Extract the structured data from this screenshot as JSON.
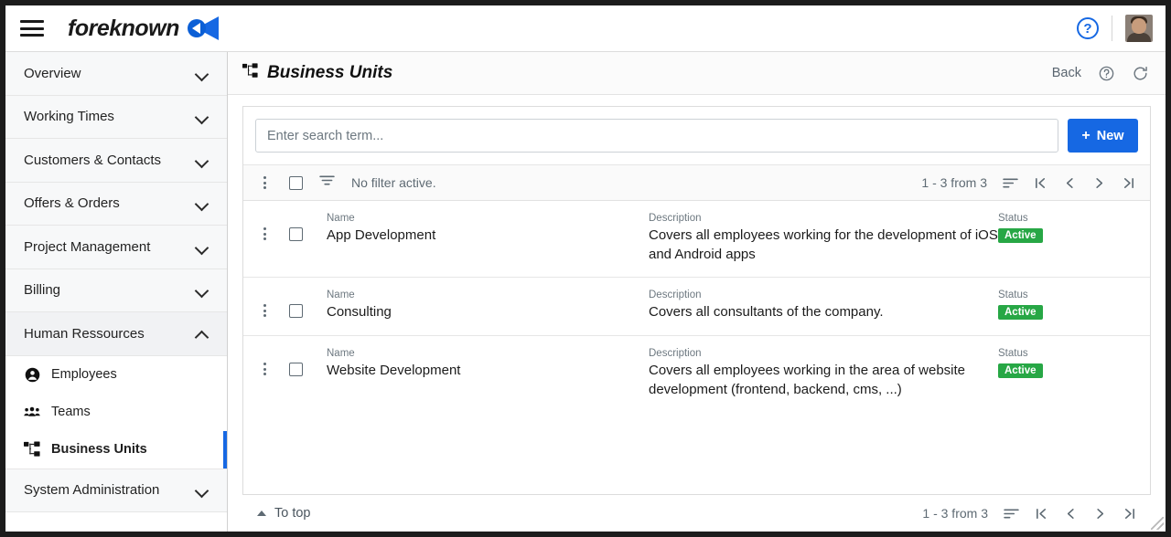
{
  "topbar": {
    "menu_icon": "hamburger-icon",
    "brand_name": "foreknown",
    "help_icon": "help-circle-icon",
    "help_glyph": "?",
    "avatar_icon": "user-avatar"
  },
  "sidebar": {
    "groups": [
      {
        "label": "Overview",
        "expanded": false
      },
      {
        "label": "Working Times",
        "expanded": false
      },
      {
        "label": "Customers & Contacts",
        "expanded": false
      },
      {
        "label": "Offers & Orders",
        "expanded": false
      },
      {
        "label": "Project Management",
        "expanded": false
      },
      {
        "label": "Billing",
        "expanded": false
      },
      {
        "label": "Human Ressources",
        "expanded": true
      }
    ],
    "sub_items": [
      {
        "label": "Employees",
        "icon": "person-icon",
        "active": false
      },
      {
        "label": "Teams",
        "icon": "people-group-icon",
        "active": false
      },
      {
        "label": "Business Units",
        "icon": "org-chart-icon",
        "active": true
      }
    ],
    "last_group": {
      "label": "System Administration",
      "expanded": false
    }
  },
  "page": {
    "title": "Business Units",
    "title_icon": "org-chart-icon",
    "back_label": "Back",
    "help_icon": "help-circle-icon",
    "refresh_icon": "refresh-icon"
  },
  "search": {
    "placeholder": "Enter search term...",
    "value": "",
    "new_label": "New",
    "new_plus": "+"
  },
  "toolbar": {
    "kebab_icon": "more-vertical-icon",
    "select_all_icon": "checkbox-icon",
    "filter_icon": "filter-icon",
    "filter_text": "No filter active.",
    "count_text": "1 - 3 from 3",
    "sort_icon": "sort-icon",
    "first_icon": "first-page-icon",
    "prev_icon": "prev-page-icon",
    "next_icon": "next-page-icon",
    "last_icon": "last-page-icon"
  },
  "table": {
    "labels": {
      "name": "Name",
      "description": "Description",
      "status": "Status"
    },
    "rows": [
      {
        "name": "App Development",
        "description": "Covers all employees working for the development of iOS and Android apps",
        "status": "Active"
      },
      {
        "name": "Consulting",
        "description": "Covers all consultants of the company.",
        "status": "Active"
      },
      {
        "name": "Website Development",
        "description": "Covers all employees working in the area of website development (frontend, backend, cms, ...)",
        "status": "Active"
      }
    ]
  },
  "footer": {
    "to_top_label": "To top",
    "count_text": "1 - 3 from 3"
  },
  "colors": {
    "accent": "#1668e3",
    "status_active": "#27a745",
    "text": "#1b1b1b",
    "muted": "#6d7880"
  }
}
